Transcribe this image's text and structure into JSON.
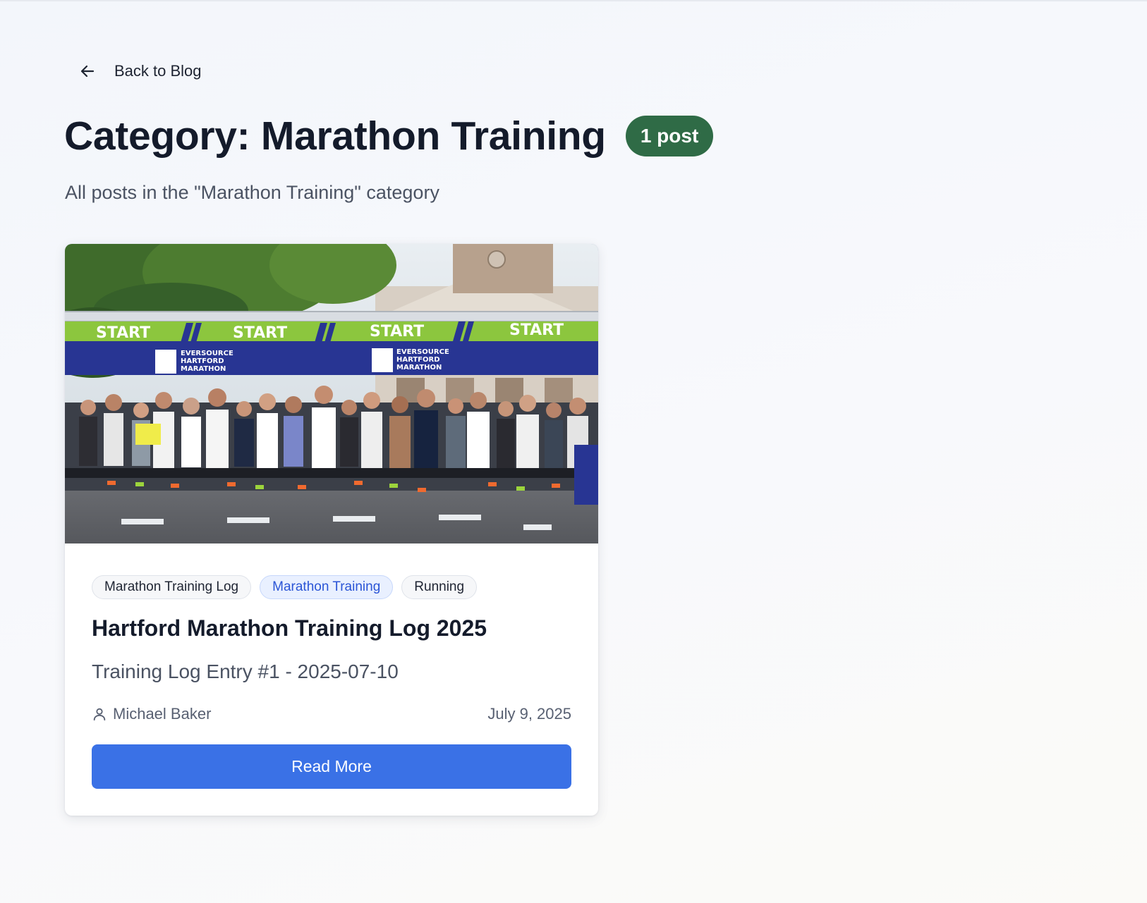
{
  "nav": {
    "back_label": "Back to Blog"
  },
  "header": {
    "title": "Category: Marathon Training",
    "count_badge": "1 post",
    "subtitle": "All posts in the \"Marathon Training\" category"
  },
  "post": {
    "image_banner_text": [
      "START",
      "START",
      "START",
      "START"
    ],
    "image_logo_text": [
      "EVERSOURCE",
      "HARTFORD",
      "MARATHON"
    ],
    "tags": [
      {
        "label": "Marathon Training Log"
      },
      {
        "label": "Marathon Training"
      },
      {
        "label": "Running"
      }
    ],
    "active_tag": "Marathon Training",
    "title": "Hartford Marathon Training Log 2025",
    "excerpt": "Training Log Entry #1 - 2025-07-10",
    "author": "Michael Baker",
    "date": "July 9, 2025",
    "read_more_label": "Read More"
  },
  "colors": {
    "badge_bg": "#2f6b46",
    "primary_button": "#3a71e6",
    "active_tag_text": "#2b55d6",
    "banner_green": "#8cc63e",
    "banner_blue": "#283593"
  },
  "icons": {
    "back": "arrow-left-icon",
    "author": "user-icon"
  }
}
